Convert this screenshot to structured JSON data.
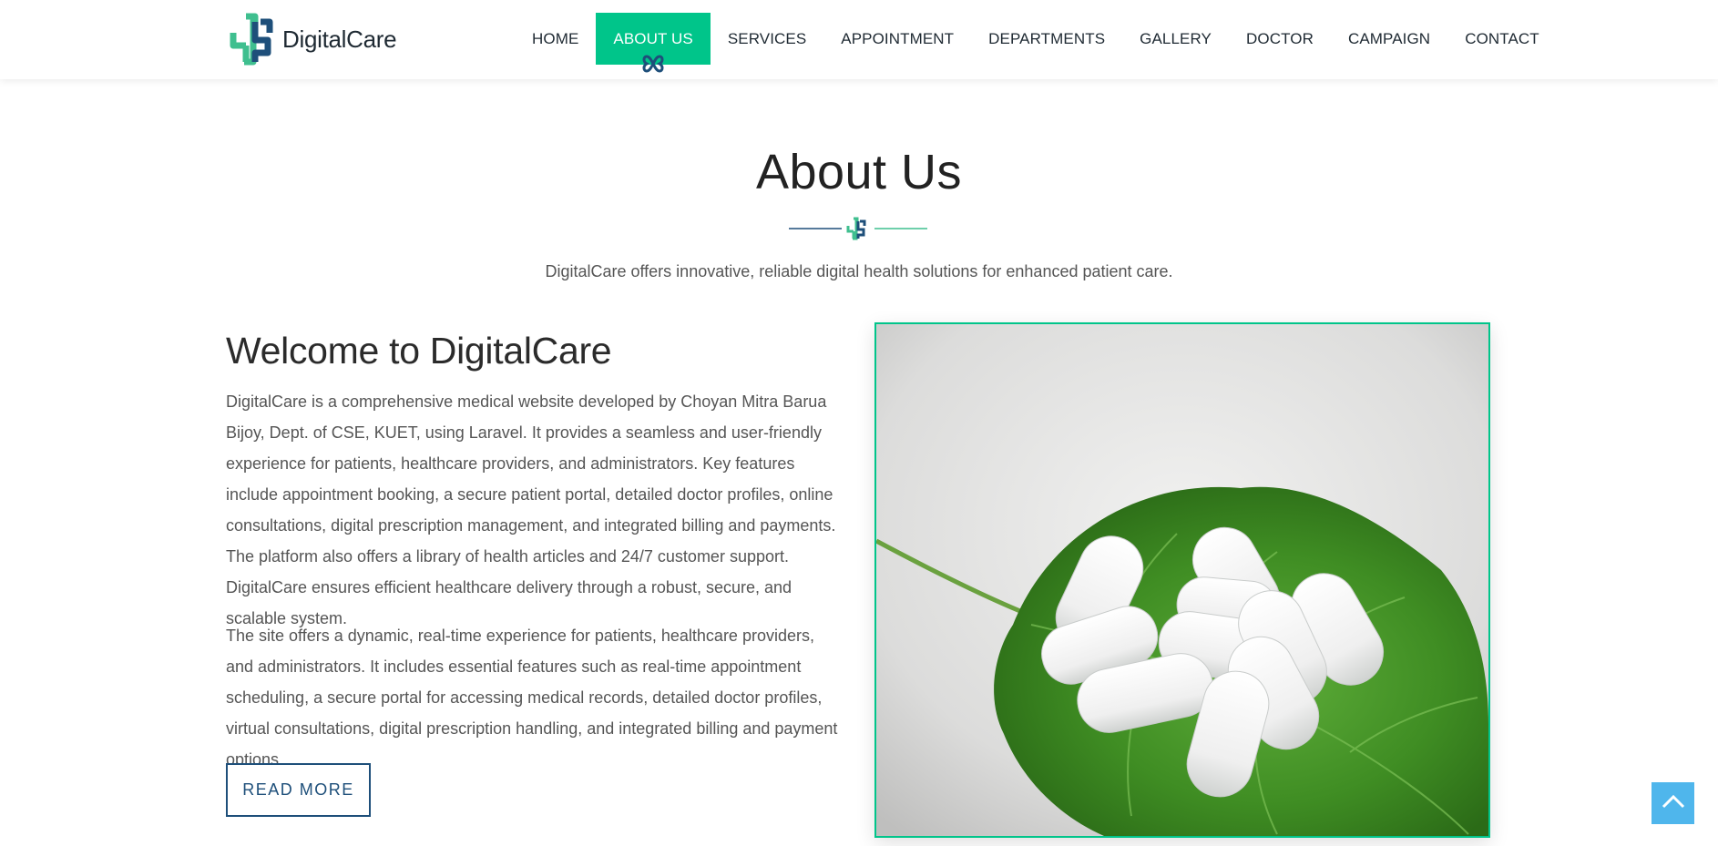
{
  "brand": {
    "name": "DigitalCare",
    "primary_color": "#00c58a",
    "secondary_color": "#1e4f7a"
  },
  "nav": {
    "items": [
      {
        "label": "HOME",
        "active": false
      },
      {
        "label": "ABOUT US",
        "active": true
      },
      {
        "label": "SERVICES",
        "active": false
      },
      {
        "label": "APPOINTMENT",
        "active": false
      },
      {
        "label": "DEPARTMENTS",
        "active": false
      },
      {
        "label": "GALLERY",
        "active": false
      },
      {
        "label": "DOCTOR",
        "active": false
      },
      {
        "label": "CAMPAIGN",
        "active": false
      },
      {
        "label": "CONTACT",
        "active": false
      }
    ]
  },
  "about": {
    "title": "About Us",
    "subtitle": "DigitalCare offers innovative, reliable digital health solutions for enhanced patient care.",
    "welcome_heading": "Welcome to DigitalCare",
    "paragraph1": "DigitalCare is a comprehensive medical website developed by Choyan Mitra Barua Bijoy, Dept. of CSE, KUET, using Laravel. It provides a seamless and user-friendly experience for patients, healthcare providers, and administrators. Key features include appointment booking, a secure patient portal, detailed doctor profiles, online consultations, digital prescription management, and integrated billing and payments. The platform also offers a library of health articles and 24/7 customer support. DigitalCare ensures efficient healthcare delivery through a robust, secure, and scalable system.",
    "paragraph2": "The site offers a dynamic, real-time experience for patients, healthcare providers, and administrators. It includes essential features such as real-time appointment scheduling, a secure portal for accessing medical records, detailed doctor profiles, virtual consultations, digital prescription handling, and integrated billing and payment options.",
    "read_more_label": "READ MORE",
    "image_subject": "white pills on green leaf"
  },
  "icons": {
    "logo": "medical-cross-logo-icon",
    "divider": "medical-cross-icon",
    "scroll_top": "chevron-up-icon"
  },
  "scroll_top_color": "#4fb6ec"
}
